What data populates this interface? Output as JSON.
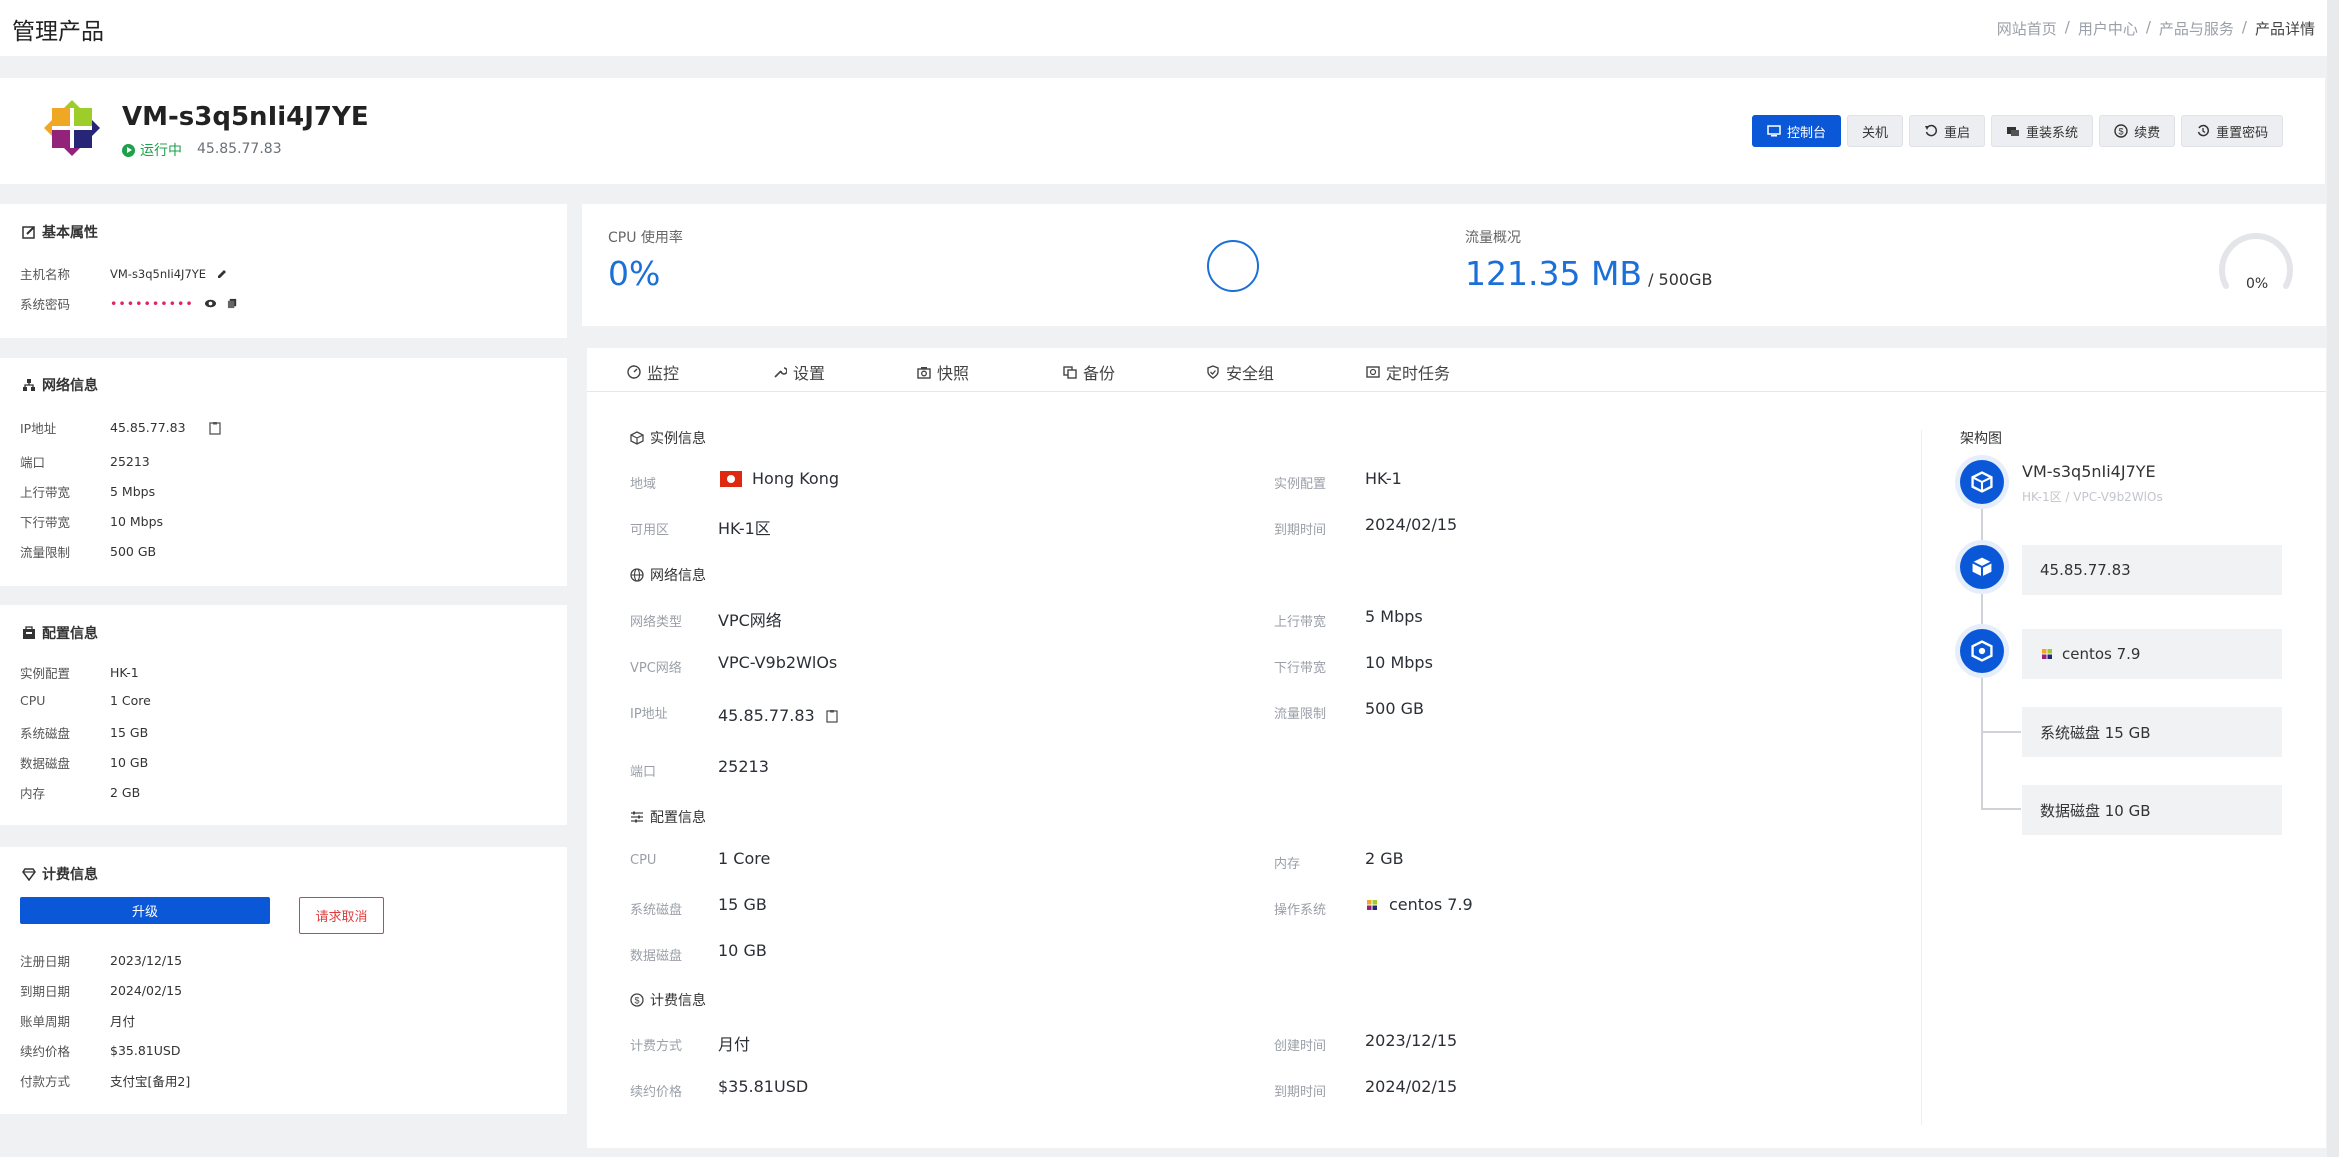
{
  "header": {
    "title": "管理产品",
    "breadcrumbs": [
      "网站首页",
      "用户中心",
      "产品与服务",
      "产品详情"
    ]
  },
  "product": {
    "name": "VM-s3q5nIi4J7YE",
    "status": "运行中",
    "ip": "45.85.77.83",
    "logo_icon": "centos-logo-icon",
    "actions": [
      {
        "label": "控制台",
        "icon": "console-icon"
      },
      {
        "label": "关机",
        "icon": ""
      },
      {
        "label": "重启",
        "icon": "restart-icon"
      },
      {
        "label": "重装系统",
        "icon": "reinstall-icon"
      },
      {
        "label": "续费",
        "icon": "dollar-icon"
      },
      {
        "label": "重置密码",
        "icon": "reset-icon"
      }
    ]
  },
  "basic": {
    "title": "基本属性",
    "hostname_label": "主机名称",
    "hostname": "VM-s3q5nIi4J7YE",
    "password_label": "系统密码",
    "password_mask": "••••••••••"
  },
  "network": {
    "title": "网络信息",
    "items": [
      {
        "k": "IP地址",
        "v": "45.85.77.83"
      },
      {
        "k": "端口",
        "v": "25213"
      },
      {
        "k": "上行带宽",
        "v": "5 Mbps"
      },
      {
        "k": "下行带宽",
        "v": "10 Mbps"
      },
      {
        "k": "流量限制",
        "v": "500 GB"
      }
    ]
  },
  "config": {
    "title": "配置信息",
    "items": [
      {
        "k": "实例配置",
        "v": "HK-1"
      },
      {
        "k": "CPU",
        "v": "1 Core"
      },
      {
        "k": "系统磁盘",
        "v": "15 GB"
      },
      {
        "k": "数据磁盘",
        "v": "10 GB"
      },
      {
        "k": "内存",
        "v": "2 GB"
      }
    ]
  },
  "billing": {
    "title": "计费信息",
    "upgrade_label": "升级",
    "cancel_label": "请求取消",
    "items": [
      {
        "k": "注册日期",
        "v": "2023/12/15"
      },
      {
        "k": "到期日期",
        "v": "2024/02/15"
      },
      {
        "k": "账单周期",
        "v": "月付"
      },
      {
        "k": "续约价格",
        "v": "$35.81USD"
      },
      {
        "k": "付款方式",
        "v": "支付宝[备用2]"
      }
    ]
  },
  "metrics": {
    "cpu_label": "CPU 使用率",
    "cpu_value": "0%",
    "cpu_fraction": 0,
    "traffic_label": "流量概况",
    "traffic_value": "121.35 MB",
    "traffic_limit": "/ 500GB",
    "traffic_gauge": "0%",
    "traffic_fraction": 0
  },
  "tabs": [
    {
      "label": "监控",
      "icon": "monitor-icon"
    },
    {
      "label": "设置",
      "icon": "wrench-icon"
    },
    {
      "label": "快照",
      "icon": "camera-icon"
    },
    {
      "label": "备份",
      "icon": "backup-icon"
    },
    {
      "label": "安全组",
      "icon": "shield-icon"
    },
    {
      "label": "定时任务",
      "icon": "schedule-icon"
    }
  ],
  "detail": {
    "instance": {
      "title": "实例信息",
      "region_k": "地域",
      "region_v": "Hong Kong",
      "zone_k": "可用区",
      "zone_v": "HK-1区",
      "spec_k": "实例配置",
      "spec_v": "HK-1",
      "expire_k": "到期时间",
      "expire_v": "2024/02/15"
    },
    "network": {
      "title": "网络信息",
      "type_k": "网络类型",
      "type_v": "VPC网络",
      "vpc_k": "VPC网络",
      "vpc_v": "VPC-V9b2WlOs",
      "ip_k": "IP地址",
      "ip_v": "45.85.77.83",
      "port_k": "端口",
      "port_v": "25213",
      "up_k": "上行带宽",
      "up_v": "5 Mbps",
      "down_k": "下行带宽",
      "down_v": "10 Mbps",
      "limit_k": "流量限制",
      "limit_v": "500 GB"
    },
    "config": {
      "title": "配置信息",
      "cpu_k": "CPU",
      "cpu_v": "1 Core",
      "sysdisk_k": "系统磁盘",
      "sysdisk_v": "15 GB",
      "datadisk_k": "数据磁盘",
      "datadisk_v": "10 GB",
      "mem_k": "内存",
      "mem_v": "2 GB",
      "os_k": "操作系统",
      "os_v": "centos 7.9"
    },
    "billing": {
      "title": "计费信息",
      "method_k": "计费方式",
      "method_v": "月付",
      "price_k": "续约价格",
      "price_v": "$35.81USD",
      "created_k": "创建时间",
      "created_v": "2023/12/15",
      "expire_k": "到期时间",
      "expire_v": "2024/02/15"
    }
  },
  "architecture": {
    "title": "架构图",
    "vm_name": "VM-s3q5nIi4J7YE",
    "vm_sub": "HK-1区 / VPC-V9b2WlOs",
    "ip": "45.85.77.83",
    "os": "centos 7.9",
    "sys_disk": "系统磁盘 15 GB",
    "data_disk": "数据磁盘 10 GB"
  },
  "colors": {
    "primary": "#0a58d8",
    "running": "#1fa04a",
    "danger": "#e03e3e",
    "metric": "#1a6fd8"
  }
}
